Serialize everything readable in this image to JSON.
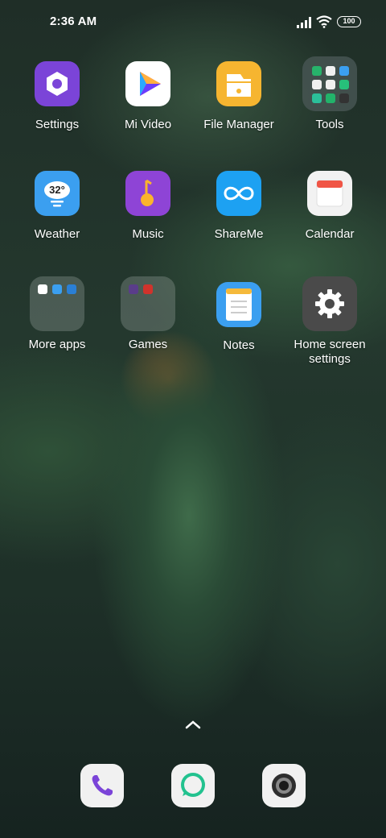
{
  "status": {
    "time": "2:36 AM",
    "battery": "100"
  },
  "apps": [
    {
      "id": "settings",
      "label": "Settings",
      "color": "#7b44d8"
    },
    {
      "id": "mi-video",
      "label": "Mi Video",
      "color": "#ffffff"
    },
    {
      "id": "file-manager",
      "label": "File Manager",
      "color": "#f6b530"
    },
    {
      "id": "tools",
      "label": "Tools"
    },
    {
      "id": "weather",
      "label": "Weather",
      "temp": "32°",
      "color": "#3b9ff0"
    },
    {
      "id": "music",
      "label": "Music",
      "color": "#8e44d6"
    },
    {
      "id": "shareme",
      "label": "ShareMe",
      "color": "#1da1f2"
    },
    {
      "id": "calendar",
      "label": "Calendar",
      "color": "#f2f2f2"
    },
    {
      "id": "more-apps",
      "label": "More apps"
    },
    {
      "id": "games",
      "label": "Games"
    },
    {
      "id": "notes",
      "label": "Notes",
      "color": "#f5b93b"
    },
    {
      "id": "home-screen-settings",
      "label": "Home screen settings",
      "color": "#4a4a4a"
    }
  ],
  "dock": [
    {
      "id": "phone",
      "icon": "phone-icon"
    },
    {
      "id": "messages",
      "icon": "chat-bubble-icon"
    },
    {
      "id": "camera",
      "icon": "camera-icon"
    }
  ]
}
